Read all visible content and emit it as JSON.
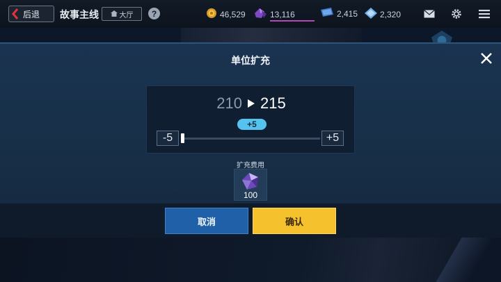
{
  "topbar": {
    "back_label": "后退",
    "title": "故事主线",
    "hall_label": "大厅",
    "help_symbol": "?",
    "resources": [
      {
        "icon": "gold-coin-icon",
        "value": "46,529"
      },
      {
        "icon": "purple-crystal-icon",
        "value": "13,116"
      },
      {
        "icon": "blue-ticket-icon",
        "value": "2,415"
      },
      {
        "icon": "blue-diamond-icon",
        "value": "2,320"
      }
    ],
    "icons": [
      "mail-icon",
      "settings-gear-icon",
      "menu-icon"
    ]
  },
  "modal": {
    "title": "单位扩充",
    "from_value": "210",
    "to_value": "215",
    "delta_label": "+5",
    "minus_label": "-5",
    "plus_label": "+5",
    "slider_level": 0,
    "cost_label": "扩充费用",
    "cost_icon": "purple-crystal-icon",
    "cost_value": "100",
    "cancel_label": "取消",
    "confirm_label": "确认"
  },
  "colors": {
    "accent_blue": "#56c3ef",
    "cancel_button": "#2060a9",
    "confirm_button": "#f5c12c",
    "back_chevron": "#e0343a"
  }
}
